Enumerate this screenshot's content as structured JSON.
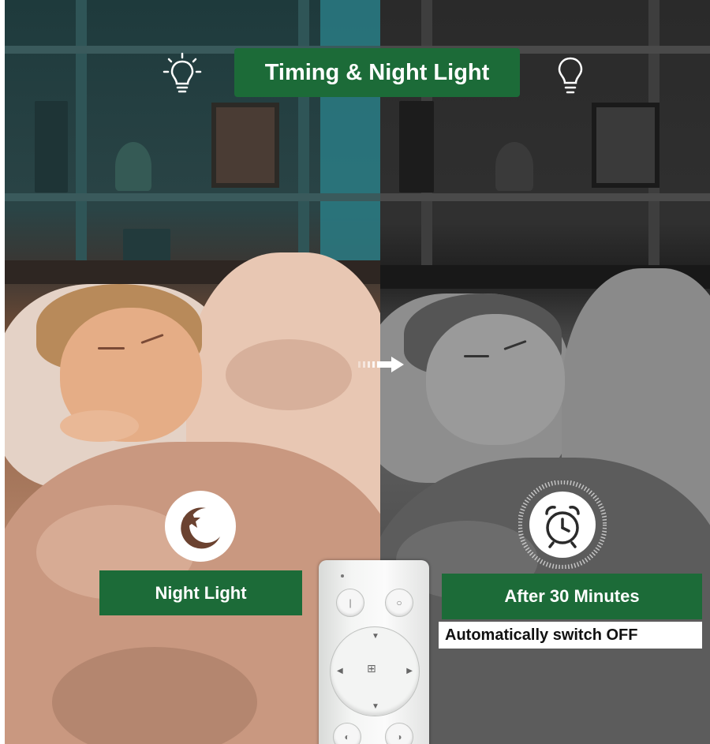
{
  "title": "Timing & Night Light",
  "left_label": "Night Light",
  "right_label": "After 30 Minutes",
  "right_sublabel": "Automatically switch OFF",
  "icons": {
    "bulb_on": "light-bulb-on-icon",
    "bulb_off": "light-bulb-off-icon",
    "arrow": "arrow-right-icon",
    "moon": "moon-star-icon",
    "clock": "alarm-clock-icon"
  },
  "colors": {
    "badge_green": "#1c6b38",
    "text_white": "#ffffff"
  }
}
